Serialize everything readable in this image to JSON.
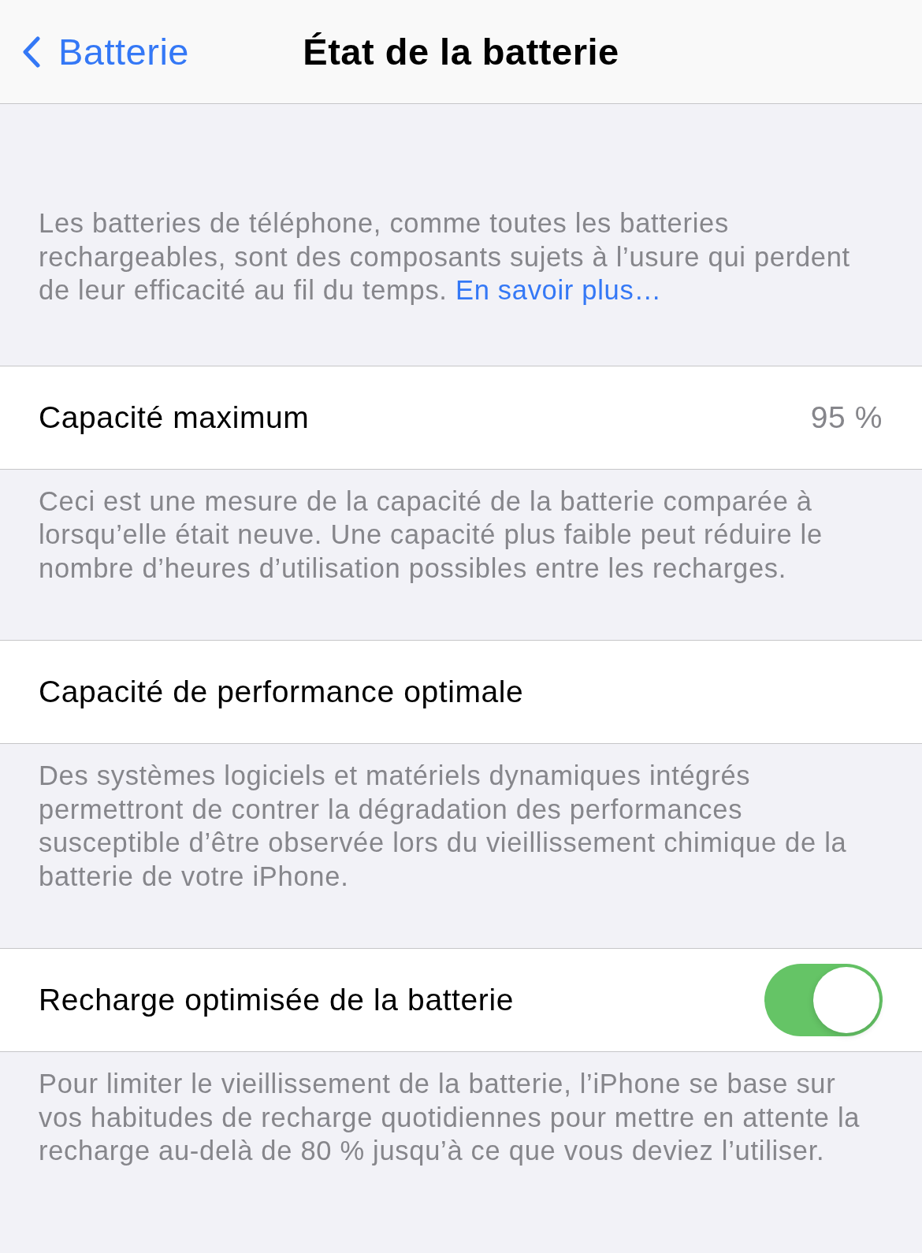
{
  "nav": {
    "back": "Batterie",
    "title": "État de la batterie"
  },
  "intro": {
    "text": "Les batteries de téléphone, comme toutes les batteries rechargeables, sont des composants sujets à l’usure qui perdent de leur efficacité au fil du temps.",
    "link": "En savoir plus…"
  },
  "sections": [
    {
      "kind": "value",
      "label": "Capacité maximum",
      "value": "95 %",
      "footer": "Ceci est une mesure de la capacité de la batterie comparée à lorsqu’elle était neuve. Une capacité plus faible peut réduire le nombre d’heures d’utilisation possibles entre les recharges."
    },
    {
      "kind": "plain",
      "label": "Capacité de performance optimale",
      "footer": "Des systèmes logiciels et matériels dynamiques intégrés permettront de contrer la dégradation des performances susceptible d’être observée lors du vieillissement chimique de la batterie de votre iPhone."
    },
    {
      "kind": "toggle",
      "label": "Recharge optimisée de la batterie",
      "on": true,
      "footer": "Pour limiter le vieillissement de la batterie, l’iPhone se base sur vos habitudes de recharge quotidiennes pour mettre en attente la recharge au-delà de 80 % jusqu’à ce que vous deviez l’utiliser."
    }
  ]
}
